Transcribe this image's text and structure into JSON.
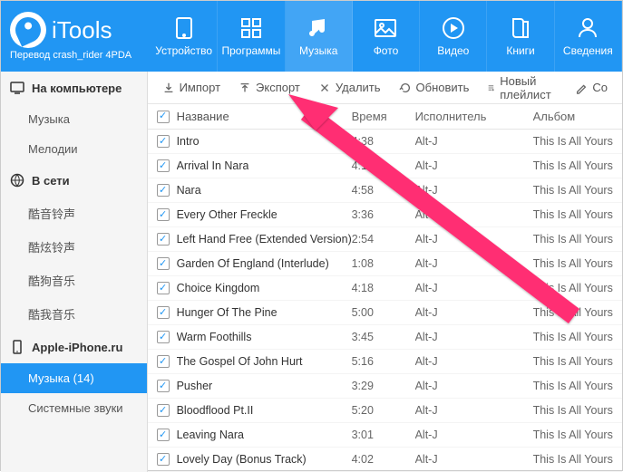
{
  "brand": {
    "name": "iTools",
    "subtitle": "Перевод crash_rider 4PDA"
  },
  "nav": [
    {
      "id": "device",
      "label": "Устройство",
      "active": false
    },
    {
      "id": "apps",
      "label": "Программы",
      "active": false
    },
    {
      "id": "music",
      "label": "Музыка",
      "active": true
    },
    {
      "id": "photo",
      "label": "Фото",
      "active": false
    },
    {
      "id": "video",
      "label": "Видео",
      "active": false
    },
    {
      "id": "books",
      "label": "Книги",
      "active": false
    },
    {
      "id": "info",
      "label": "Сведения",
      "active": false
    }
  ],
  "sidebar": {
    "sections": [
      {
        "id": "computer",
        "title": "На компьютере",
        "items": [
          {
            "id": "sb-music",
            "label": "Музыка"
          },
          {
            "id": "sb-melodies",
            "label": "Мелодии"
          }
        ]
      },
      {
        "id": "network",
        "title": "В сети",
        "items": [
          {
            "id": "sb-n1",
            "label": "酷音铃声"
          },
          {
            "id": "sb-n2",
            "label": "酷炫铃声"
          },
          {
            "id": "sb-n3",
            "label": "酷狗音乐"
          },
          {
            "id": "sb-n4",
            "label": "酷我音乐"
          }
        ]
      },
      {
        "id": "device",
        "title": "Apple-iPhone.ru",
        "items": [
          {
            "id": "sb-dmusic",
            "label": "Музыка (14)",
            "active": true
          },
          {
            "id": "sb-sys",
            "label": "Системные звуки"
          }
        ]
      }
    ]
  },
  "toolbar": {
    "import": "Импорт",
    "export": "Экспорт",
    "delete": "Удалить",
    "refresh": "Обновить",
    "playlist": "Новый плейлист",
    "create": "Со"
  },
  "columns": {
    "name": "Название",
    "time": "Время",
    "artist": "Исполнитель",
    "album": "Альбом"
  },
  "tracks": [
    {
      "name": "Intro",
      "time": "4:38",
      "artist": "Alt-J",
      "album": "This Is All Yours"
    },
    {
      "name": "Arrival In Nara",
      "time": "4:13",
      "artist": "Alt-J",
      "album": "This Is All Yours"
    },
    {
      "name": "Nara",
      "time": "4:58",
      "artist": "Alt-J",
      "album": "This Is All Yours"
    },
    {
      "name": "Every Other Freckle",
      "time": "3:36",
      "artist": "Alt-J",
      "album": "This Is All Yours"
    },
    {
      "name": "Left Hand Free (Extended Version)",
      "time": "2:54",
      "artist": "Alt-J",
      "album": "This Is All Yours"
    },
    {
      "name": "Garden Of England (Interlude)",
      "time": "1:08",
      "artist": "Alt-J",
      "album": "This Is All Yours"
    },
    {
      "name": "Choice Kingdom",
      "time": "4:18",
      "artist": "Alt-J",
      "album": "This Is All Yours"
    },
    {
      "name": "Hunger Of The Pine",
      "time": "5:00",
      "artist": "Alt-J",
      "album": "This Is All Yours"
    },
    {
      "name": "Warm Foothills",
      "time": "3:45",
      "artist": "Alt-J",
      "album": "This Is All Yours"
    },
    {
      "name": "The Gospel Of John Hurt",
      "time": "5:16",
      "artist": "Alt-J",
      "album": "This Is All Yours"
    },
    {
      "name": "Pusher",
      "time": "3:29",
      "artist": "Alt-J",
      "album": "This Is All Yours"
    },
    {
      "name": "Bloodflood Pt.II",
      "time": "5:20",
      "artist": "Alt-J",
      "album": "This Is All Yours"
    },
    {
      "name": "Leaving Nara",
      "time": "3:01",
      "artist": "Alt-J",
      "album": "This Is All Yours"
    },
    {
      "name": "Lovely Day (Bonus Track)",
      "time": "4:02",
      "artist": "Alt-J",
      "album": "This Is All Yours"
    }
  ],
  "arrow_color": "#ff2d73"
}
